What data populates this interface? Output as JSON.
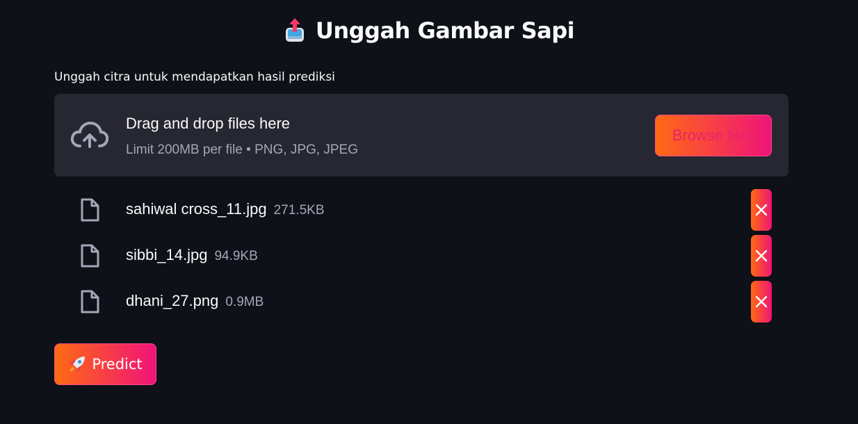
{
  "header": {
    "title": "Unggah Gambar Sapi",
    "title_icon": "inbox-tray-upload-icon"
  },
  "uploader": {
    "label": "Unggah citra untuk mendapatkan hasil prediksi",
    "drop_text": "Drag and drop files here",
    "limit_text": "Limit 200MB per file • PNG, JPG, JPEG",
    "browse_label": "Browse files",
    "icon": "cloud-upload-icon"
  },
  "files": [
    {
      "name": "sahiwal cross_11.jpg",
      "size": "271.5KB"
    },
    {
      "name": "sibbi_14.jpg",
      "size": "94.9KB"
    },
    {
      "name": "dhani_27.png",
      "size": "0.9MB"
    }
  ],
  "predict": {
    "label": "Predict",
    "icon": "rocket-icon"
  },
  "colors": {
    "background": "#0e1117",
    "panel": "#262730",
    "accent_start": "#ff6a13",
    "accent_end": "#f01378",
    "muted_text": "#a3a8b8"
  }
}
